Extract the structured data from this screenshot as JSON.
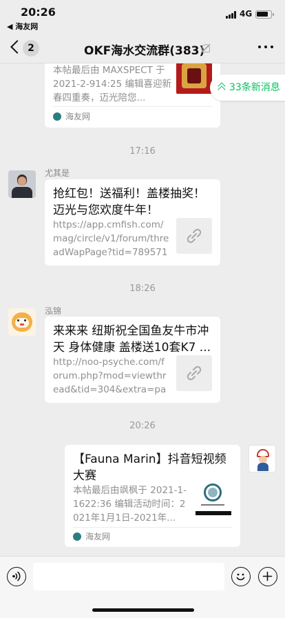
{
  "status": {
    "time": "20:26",
    "back_app": "◀ 海友网",
    "network": "4G"
  },
  "nav": {
    "unread_count": "2",
    "title": "OKF海水交流群(383)"
  },
  "new_messages": "33条新消息",
  "messages": [
    {
      "type": "card-partial",
      "desc": "本帖最后由 MAXSPECT 于 2021-2-914:25 编辑喜迎新春四重奏，迈光陪您...",
      "source": "海友网"
    },
    {
      "type": "time",
      "text": "17:16"
    },
    {
      "type": "link",
      "sender": "尤其是",
      "title": "抢红包！送福利！盖楼抽奖！迈光与您欢度牛年！",
      "url": "https://app.cmfish.com/mag/circle/v1/forum/threadWapPage?tid=789571&..."
    },
    {
      "type": "time",
      "text": "18:26"
    },
    {
      "type": "link",
      "sender": "泓锦",
      "title": "来来来 纽斯祝全国鱼友牛市冲天 身体健康 盖楼送10套K7 ...",
      "url": "http://noo-psyche.com/forum.php?mod=viewthread&tid=304&extra=page..."
    },
    {
      "type": "time",
      "text": "20:26"
    },
    {
      "type": "card-self",
      "title": "【Fauna Marin】抖音短视频大赛",
      "desc": "本帖最后由飒枫于 2021-1-1622:36 编辑活动时间：2021年1月1日-2021年...",
      "source": "海友网"
    }
  ],
  "colors": {
    "accent": "#07c160",
    "background": "#ededed",
    "card": "#ffffff"
  },
  "icons": [
    "voice-icon",
    "emoji-icon",
    "plus-icon",
    "link-icon",
    "mute-icon",
    "more-icon"
  ]
}
